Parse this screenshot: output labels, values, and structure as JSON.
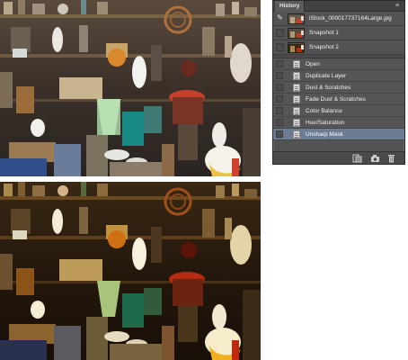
{
  "panel": {
    "tab_label": "History",
    "menu_icon": "panel-menu-icon",
    "snapshots": [
      {
        "label": "iStock_000017737164Large.jpg",
        "source_selected": true
      },
      {
        "label": "Snapshot 1",
        "source_selected": false
      },
      {
        "label": "Snapshot 2",
        "source_selected": false
      }
    ],
    "steps": [
      {
        "label": "Open",
        "active": false
      },
      {
        "label": "Duplicate Layer",
        "active": false
      },
      {
        "label": "Dust & Scratches",
        "active": false
      },
      {
        "label": "Fade Dust & Scratches",
        "active": false
      },
      {
        "label": "Color Balance",
        "active": false
      },
      {
        "label": "Hue/Saturation",
        "active": false
      },
      {
        "label": "Unsharp Mask",
        "active": true
      }
    ],
    "footer_buttons": [
      {
        "name": "new-document-from-state-button",
        "icon": "new-document-icon"
      },
      {
        "name": "create-snapshot-button",
        "icon": "camera-icon"
      },
      {
        "name": "delete-state-button",
        "icon": "trash-icon"
      }
    ]
  },
  "photos": {
    "top": {
      "description_icon": "antique-shop-photo-original"
    },
    "bottom": {
      "description_icon": "antique-shop-photo-adjusted"
    }
  },
  "colors": {
    "panel_bg": "#535353",
    "active_row": "#6c7d93"
  }
}
